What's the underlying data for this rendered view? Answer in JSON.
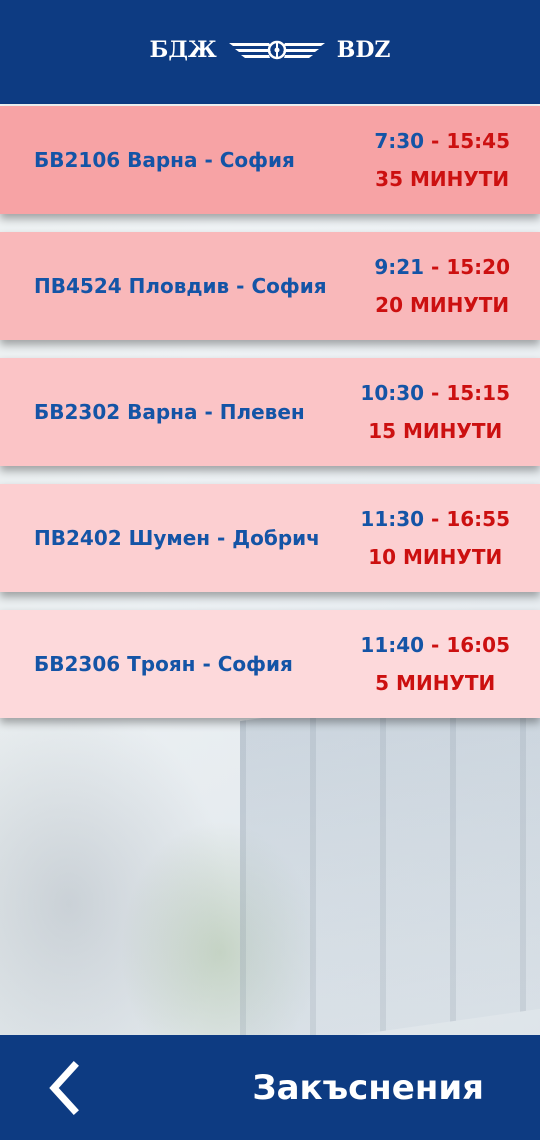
{
  "header": {
    "logo_left": "БДЖ",
    "logo_right": "BDZ",
    "logo_icon": "winged-wheel-icon",
    "background_color": "#0d3b82"
  },
  "delays": [
    {
      "route": "БВ2106 Варна - София",
      "departure": "7:30",
      "separator": " - ",
      "arrival": "15:45",
      "delay": "35 МИНУТИ",
      "color": "#f7a3a5"
    },
    {
      "route": "ПВ4524 Пловдив - София",
      "departure": "9:21",
      "separator": " - ",
      "arrival": "15:20",
      "delay": "20 МИНУТИ",
      "color": "#f9b8ba"
    },
    {
      "route": "БВ2302 Варна - Плевен",
      "departure": "10:30",
      "separator": " - ",
      "arrival": "15:15",
      "delay": "15 МИНУТИ",
      "color": "#fbc4c6"
    },
    {
      "route": "ПВ2402 Шумен - Добрич",
      "departure": "11:30",
      "separator": " - ",
      "arrival": "16:55",
      "delay": "10 МИНУТИ",
      "color": "#fccfd1"
    },
    {
      "route": "БВ2306 Троян - София",
      "departure": "11:40",
      "separator": " - ",
      "arrival": "16:05",
      "delay": "5 МИНУТИ",
      "color": "#fdd9db"
    }
  ],
  "footer": {
    "back_icon": "chevron-left-icon",
    "title": "Закъснения",
    "background_color": "#0d3b82"
  }
}
